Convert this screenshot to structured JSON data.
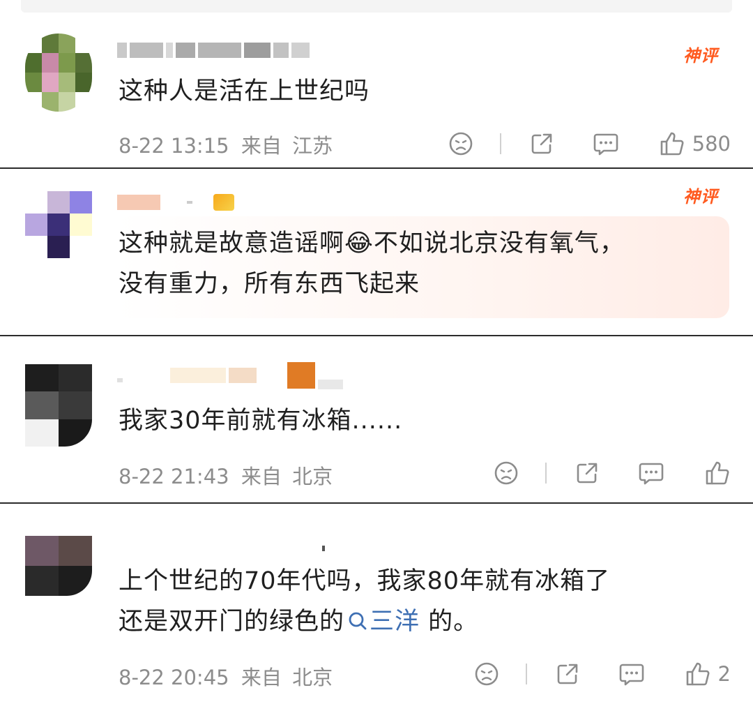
{
  "comments": [
    {
      "text_lines": [
        "这种人是活在上世纪吗"
      ],
      "badge": "神评",
      "date": "8-22 13:15",
      "from_label": "来自",
      "location": "江苏",
      "likes": "580"
    },
    {
      "text_lines": [
        "这种就是故意造谣啊😂不如说北京没有氧气，",
        "没有重力，所有东西飞起来"
      ],
      "badge": "神评"
    },
    {
      "text_lines": [
        "我家30年前就有冰箱......"
      ],
      "date": "8-22 21:43",
      "from_label": "来自",
      "location": "北京",
      "likes": ""
    },
    {
      "text_line1": "上个世纪的70年代吗，我家80年就有冰箱了",
      "text_line2_pre": "还是双开门的绿色的",
      "search_link": "三洋",
      "text_line2_post": " 的。",
      "date": "8-22 20:45",
      "from_label": "来自",
      "location": "北京",
      "likes": "2"
    }
  ],
  "colors": {
    "badge": "#ff5a1f",
    "meta": "#8c8c8c",
    "link": "#3e6fb3",
    "divider": "#2b2b2b"
  },
  "icons": [
    "dislike-face-icon",
    "share-icon",
    "reply-comment-icon",
    "thumb-up-icon",
    "search-icon"
  ]
}
